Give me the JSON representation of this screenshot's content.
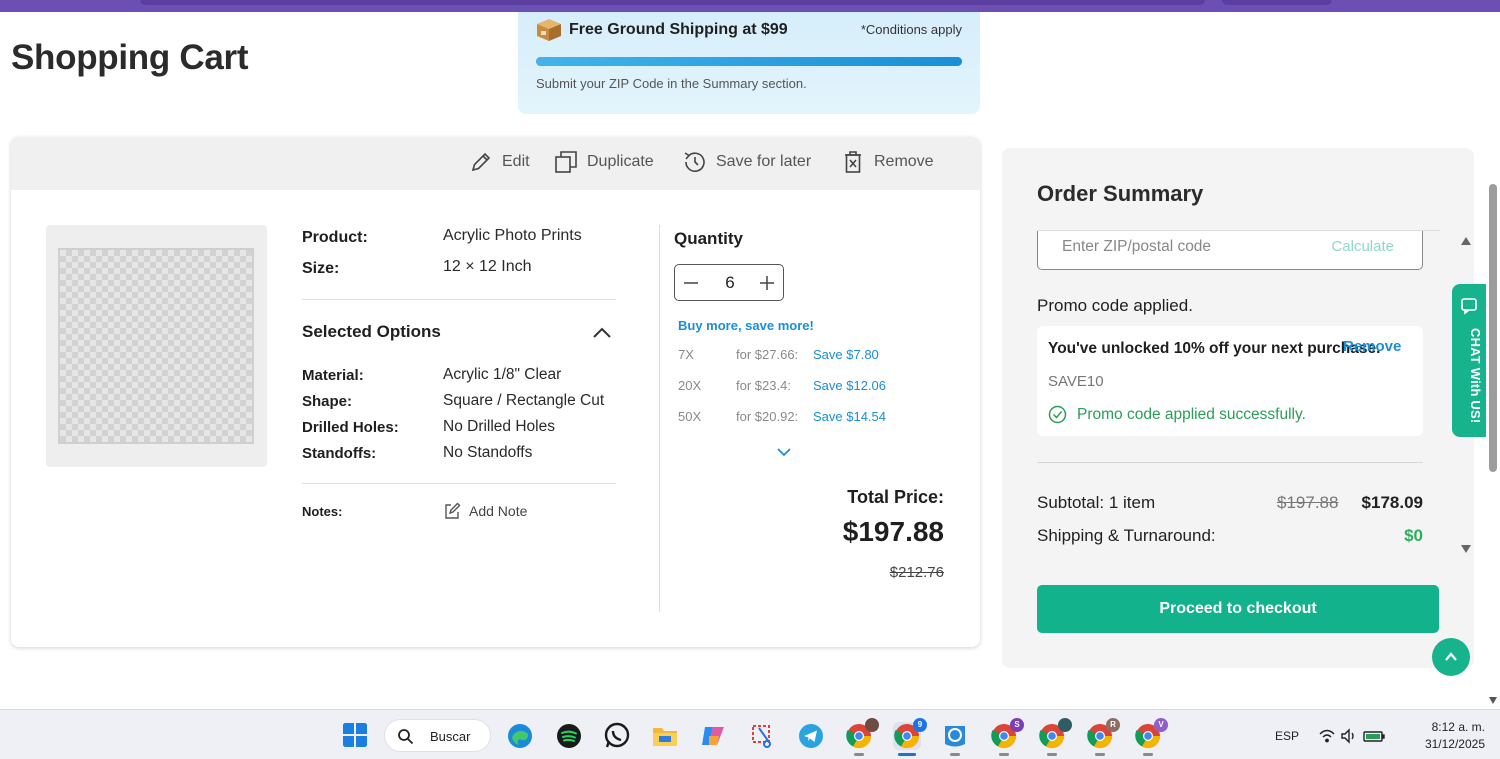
{
  "page": {
    "title": "Shopping Cart"
  },
  "shipping_banner": {
    "title": "Free Ground Shipping at $99",
    "conditions": "*Conditions apply",
    "progress_fraction": 1.0,
    "subtext": "Submit your ZIP Code in the Summary section."
  },
  "cart": {
    "toolbar": {
      "edit": "Edit",
      "duplicate": "Duplicate",
      "save_for_later": "Save for later",
      "remove": "Remove"
    },
    "item": {
      "product_label": "Product:",
      "product_value": "Acrylic Photo Prints",
      "size_label": "Size:",
      "size_value": "12 × 12 Inch",
      "selected_options_title": "Selected Options",
      "options": [
        {
          "label": "Material:",
          "value": "Acrylic 1/8\" Clear"
        },
        {
          "label": "Shape:",
          "value": "Square / Rectangle Cut"
        },
        {
          "label": "Drilled Holes:",
          "value": "No Drilled Holes"
        },
        {
          "label": "Standoffs:",
          "value": "No Standoffs"
        }
      ],
      "notes_label": "Notes:",
      "add_note": "Add Note"
    },
    "quantity": {
      "title": "Quantity",
      "value": "6",
      "buy_more": "Buy more, save more!",
      "tiers": [
        {
          "qty": "7X",
          "price": "for $27.66:",
          "save": "Save $7.80"
        },
        {
          "qty": "20X",
          "price": "for $23.4:",
          "save": "Save $12.06"
        },
        {
          "qty": "50X",
          "price": "for $20.92:",
          "save": "Save $14.54"
        }
      ]
    },
    "total": {
      "label": "Total Price:",
      "value": "$197.88",
      "original": "$212.76"
    }
  },
  "summary": {
    "title": "Order Summary",
    "zip_placeholder": "Enter ZIP/postal code",
    "calculate": "Calculate",
    "promo_heading": "Promo code applied.",
    "promo_message": "You've unlocked 10% off your next purchase.",
    "promo_remove": "Remove",
    "promo_code": "SAVE10",
    "promo_success": "Promo code applied successfully.",
    "subtotal_label": "Subtotal: 1 item",
    "subtotal_original": "$197.88",
    "subtotal_value": "$178.09",
    "shipping_label": "Shipping & Turnaround:",
    "shipping_value": "$0",
    "checkout": "Proceed to checkout"
  },
  "chat_tab": {
    "label": "CHAT With US!"
  },
  "colors": {
    "accent": "#16b38c",
    "link": "#1a8fd6",
    "success": "#2a9d5a"
  },
  "taskbar": {
    "search": "Buscar",
    "icons": [
      "windows-start",
      "edge",
      "spotify",
      "whatsapp",
      "file-explorer",
      "copilot",
      "snipping-tool",
      "telegram",
      "chrome-profile",
      "chrome-active",
      "edge-alt",
      "chrome-s",
      "chrome-profile-2",
      "chrome-r",
      "chrome-v"
    ],
    "badges": {
      "chrome_active": "9",
      "chrome_s": "S",
      "chrome_r": "R",
      "chrome_v": "V"
    },
    "language": "ESP",
    "time": "8:12 a. m.",
    "date": "31/12/2025"
  }
}
